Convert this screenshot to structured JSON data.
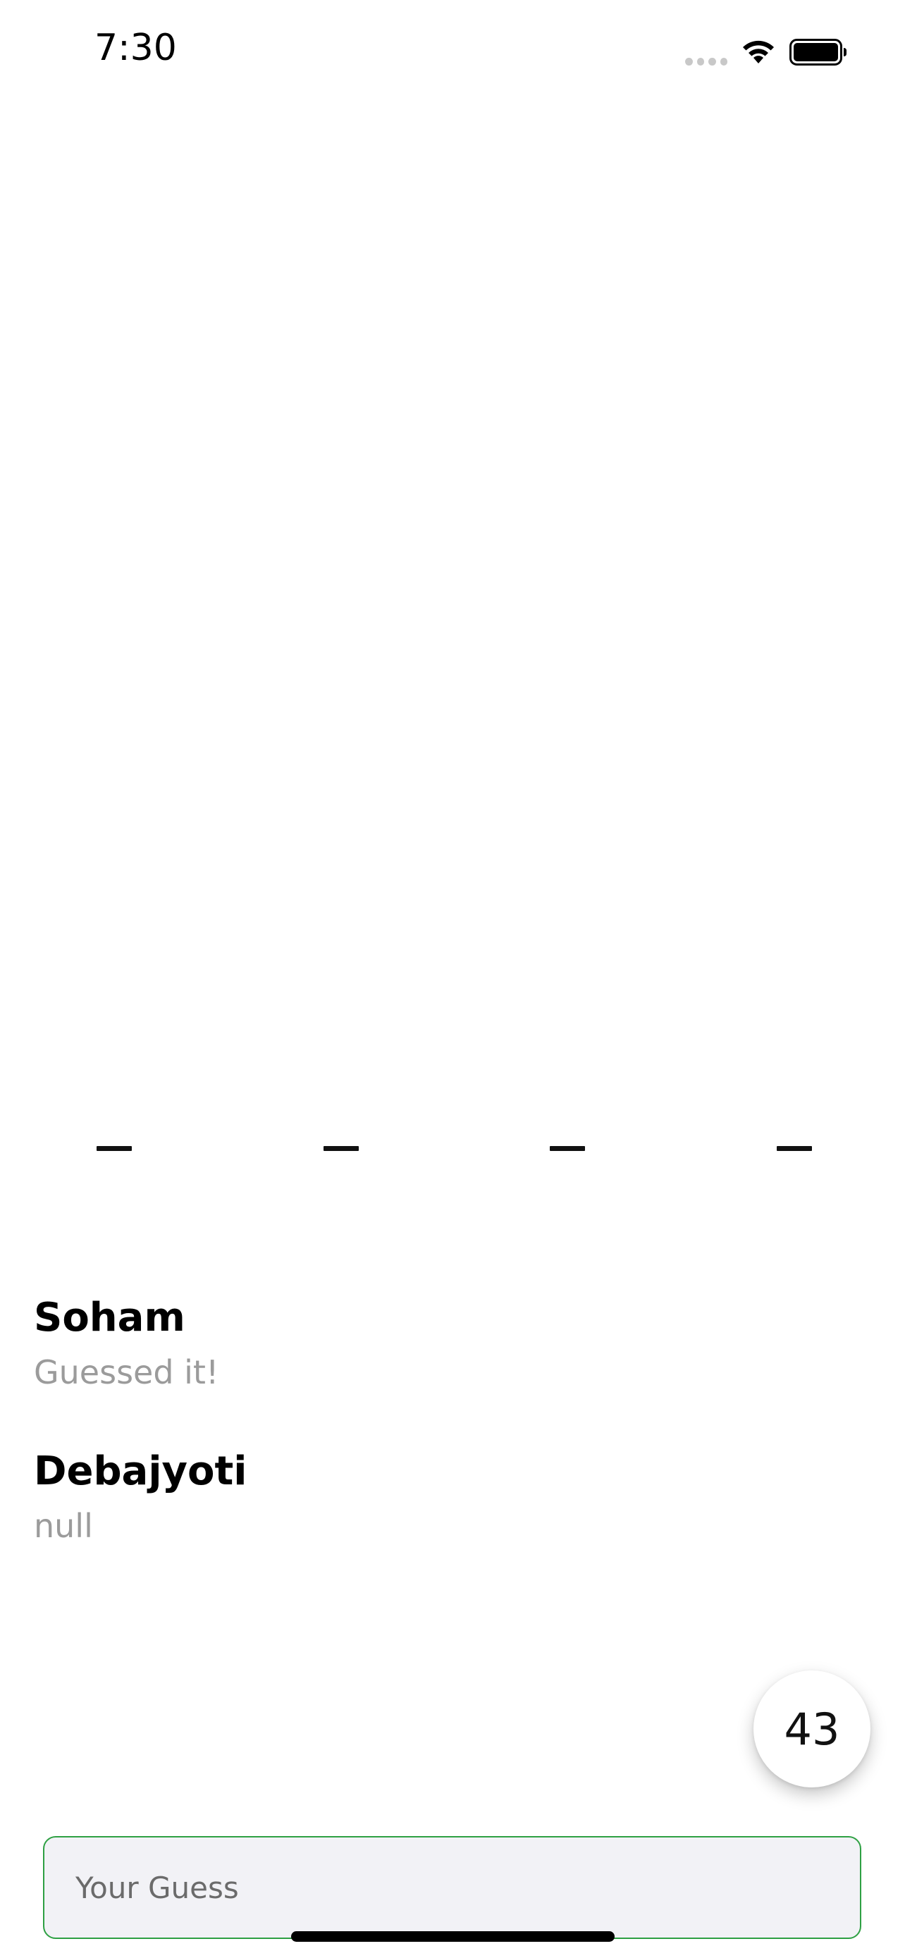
{
  "status_bar": {
    "time": "7:30"
  },
  "word": {
    "blank_count": 4
  },
  "players": [
    {
      "name": "Soham",
      "status": "Guessed it!"
    },
    {
      "name": "Debajyoti",
      "status": "null"
    }
  ],
  "timer": {
    "value": "43"
  },
  "guess": {
    "placeholder": "Your Guess",
    "value": ""
  },
  "colors": {
    "accent_border": "#2ea043",
    "status_text": "#9b9b9b",
    "input_background": "#f2f2f6"
  }
}
